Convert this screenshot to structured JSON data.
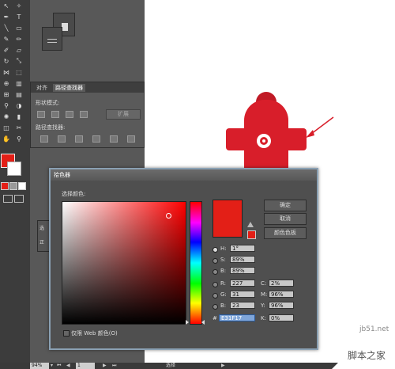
{
  "colors": {
    "workspace": "#535353",
    "fill": "#e31f17",
    "hydrant": "#d81e2a",
    "arrow": "#d81e2a"
  },
  "pathfinder": {
    "tabs": [
      "对齐",
      "路径查找器"
    ],
    "shape_modes_label": "形状模式:",
    "expand_button": "扩展",
    "pathfinders_label": "路径查找器:"
  },
  "picker": {
    "title": "拾色器",
    "select_color_label": "选择颜色:",
    "ok": "确定",
    "cancel": "取消",
    "swatches": "颜色色板",
    "web_only": "仅限 Web 颜色(O)",
    "hsb": [
      {
        "label": "H:",
        "value": "1°"
      },
      {
        "label": "S:",
        "value": "89%"
      },
      {
        "label": "B:",
        "value": "89%"
      }
    ],
    "rgb": [
      {
        "label": "R:",
        "value": "227"
      },
      {
        "label": "G:",
        "value": "31"
      },
      {
        "label": "B:",
        "value": "23"
      }
    ],
    "cmyk": [
      {
        "label": "C:",
        "value": "2%"
      },
      {
        "label": "M:",
        "value": "96%"
      },
      {
        "label": "Y:",
        "value": "96%"
      },
      {
        "label": "K:",
        "value": "0%"
      }
    ],
    "hex_prefix": "#",
    "hex": "E31F17"
  },
  "statusbar": {
    "zoom": "94%",
    "page": "1",
    "mode": "选择"
  },
  "small_panel": {
    "label_top": "选",
    "label_bottom": "正"
  },
  "watermark": {
    "site": "jb51.net",
    "name": "脚本之家"
  }
}
